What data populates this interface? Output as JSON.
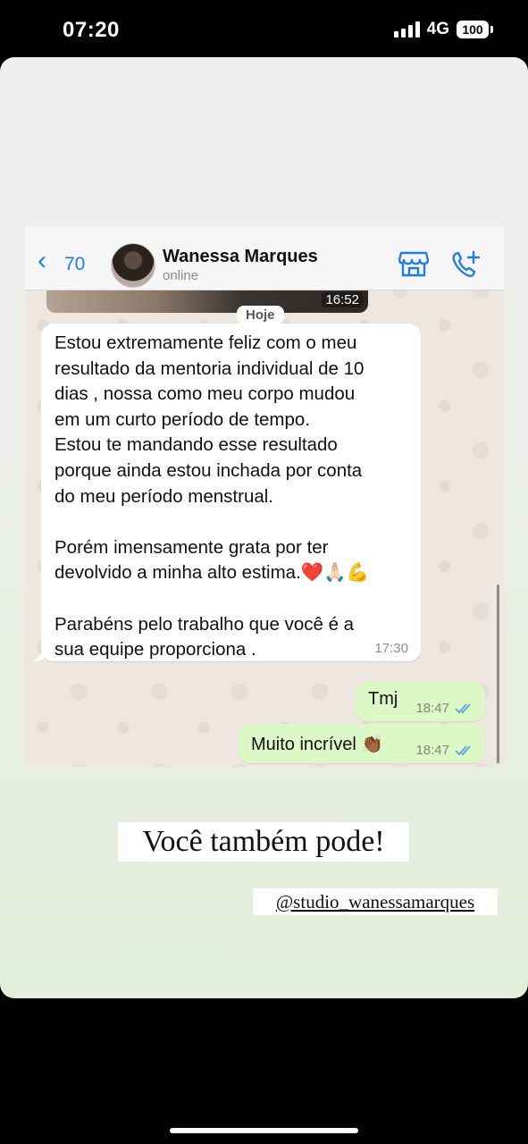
{
  "status_bar": {
    "time": "07:20",
    "network": "4G",
    "battery": "100"
  },
  "chat": {
    "back_count": "70",
    "contact_name": "Wanessa Marques",
    "contact_status": "online",
    "media_time": "16:52",
    "day_label": "Hoje",
    "incoming_message": "Estou extremamente feliz com o meu\nresultado da mentoria individual de 10\ndias , nossa como meu corpo mudou\nem um curto período de tempo.\nEstou te mandando esse resultado\nporque ainda estou inchada por conta\ndo meu período menstrual.\n\nPorém imensamente grata por ter\ndevolvido a minha alto estima.❤️🙏🏻💪\n\nParabéns pelo trabalho que você é a\nsua equipe proporciona .",
    "incoming_time": "17:30",
    "outgoing": [
      {
        "text": "Tmj",
        "time": "18:47"
      },
      {
        "text": "Muito incrível 👏🏾",
        "time": "18:47"
      }
    ],
    "colors": {
      "accent": "#1f7ee8",
      "outgoing_bubble": "#dcf8c6",
      "read_tick": "#4fa3e0"
    }
  },
  "story": {
    "caption": "Você também pode!",
    "handle": "@studio_wanessamarques"
  }
}
